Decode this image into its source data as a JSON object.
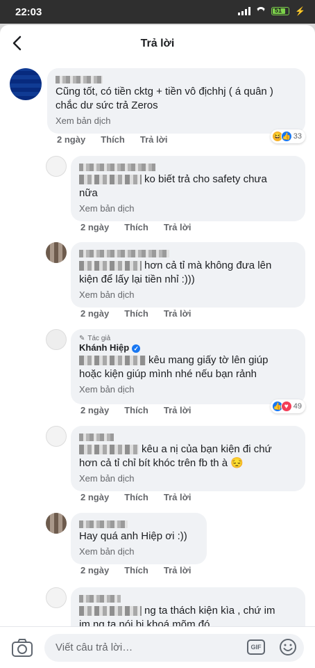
{
  "status_bar": {
    "time": "22:03",
    "battery": "51"
  },
  "header": {
    "title": "Trả lời"
  },
  "comments": [
    {
      "name_hidden": true,
      "lines": [
        "Cũng tốt, có tiền cktg + tiền vô địchhj ( á quân )",
        "chắc dư sức trả Zeros"
      ],
      "translate": "Xem bản dịch",
      "time": "2 ngày",
      "like": "Thích",
      "reply": "Trả lời",
      "reactions": {
        "icons": [
          "haha-icon",
          "like-icon"
        ],
        "count": "33"
      }
    },
    {
      "lines": [
        "ko biết trả cho safety chưa",
        "nữa"
      ],
      "translate": "Xem bản dịch",
      "time": "2 ngày",
      "like": "Thích",
      "reply": "Trả lời"
    },
    {
      "lines": [
        "hơn cả tỉ mà không đưa lên",
        "kiện để lấy lại tiền nhỉ :)))"
      ],
      "translate": "Xem bản dịch",
      "time": "2 ngày",
      "like": "Thích",
      "reply": "Trả lời"
    },
    {
      "author_tag": "Tác giả",
      "name": "Khánh Hiệp",
      "lines": [
        "kêu mang giấy tờ lên giúp",
        "hoặc kiện giúp mình nhé nếu bạn rảnh"
      ],
      "translate": "Xem bản dịch",
      "time": "2 ngày",
      "like": "Thích",
      "reply": "Trả lời",
      "reactions": {
        "icons": [
          "like-icon",
          "love-icon"
        ],
        "count": "49"
      }
    },
    {
      "lines": [
        "kêu a nị của bạn kiện đi chứ",
        "hơn cả tỉ chỉ bít khóc trên fb th à 😔"
      ],
      "translate": "Xem bản dịch",
      "time": "2 ngày",
      "like": "Thích",
      "reply": "Trả lời"
    },
    {
      "lines": [
        "Hay quá anh Hiệp ơi :))"
      ],
      "translate": "Xem bản dịch",
      "time": "2 ngày",
      "like": "Thích",
      "reply": "Trả lời"
    },
    {
      "lines": [
        "ng ta thách kiện kìa , chứ im",
        "im ng ta nói bị khoá mõm đó"
      ]
    }
  ],
  "composer": {
    "placeholder": "Viết câu trả lời…",
    "gif_label": "GIF"
  }
}
